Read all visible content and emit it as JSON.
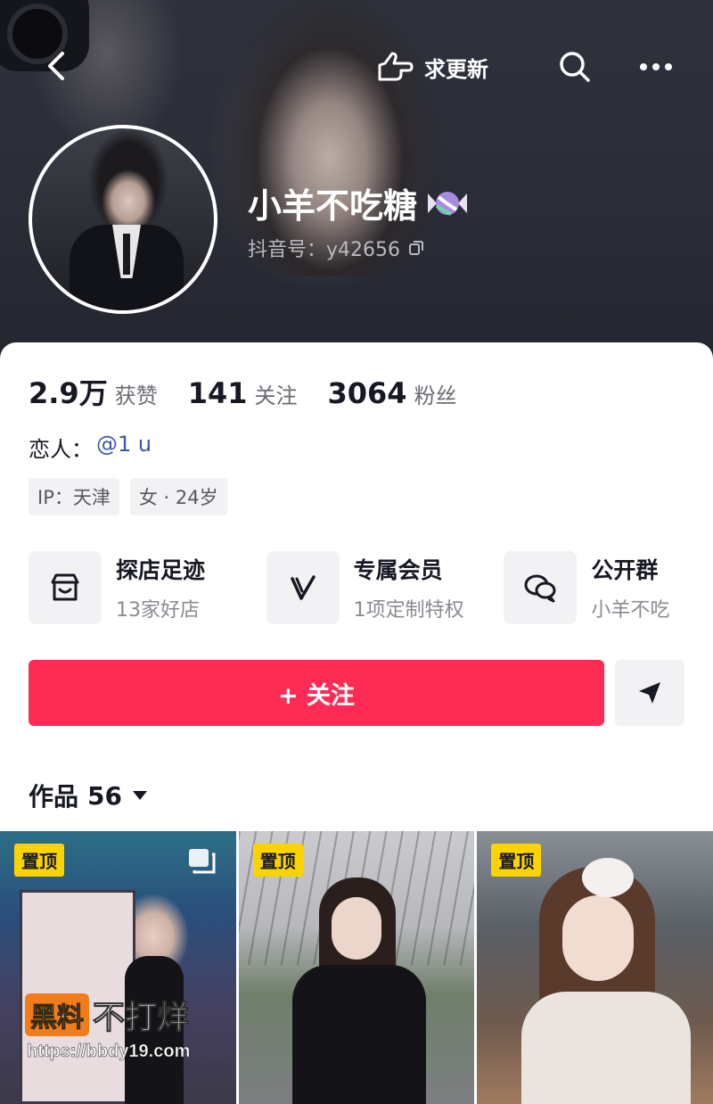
{
  "header": {
    "update_label": "求更新",
    "nickname": "小羊不吃糖",
    "account_id": "抖音号：y42656"
  },
  "stats": [
    {
      "num": "2.9万",
      "label": "获赞"
    },
    {
      "num": "141",
      "label": "关注"
    },
    {
      "num": "3064",
      "label": "粉丝"
    }
  ],
  "profile": {
    "lover_label": "恋人：",
    "lover_link": "@1 u",
    "tags": [
      "IP：天津",
      "女 · 24岁"
    ]
  },
  "services": [
    {
      "icon": "shop-icon",
      "title": "探店足迹",
      "sub": "13家好店"
    },
    {
      "icon": "vip-icon",
      "title": "专属会员",
      "sub": "1项定制特权"
    },
    {
      "icon": "group-chat-icon",
      "title": "公开群",
      "sub": "小羊不吃"
    }
  ],
  "actions": {
    "follow_label": "+ 关注"
  },
  "works": {
    "label": "作品",
    "count": "56"
  },
  "grid": {
    "pin_label": "置顶",
    "watermark_box": "黑料",
    "watermark_text": "不打烊",
    "watermark_url": "https://bbdy19.com"
  },
  "colors": {
    "accent": "#fe2c55",
    "pin": "#fbd400",
    "link": "#3d5a9c"
  }
}
